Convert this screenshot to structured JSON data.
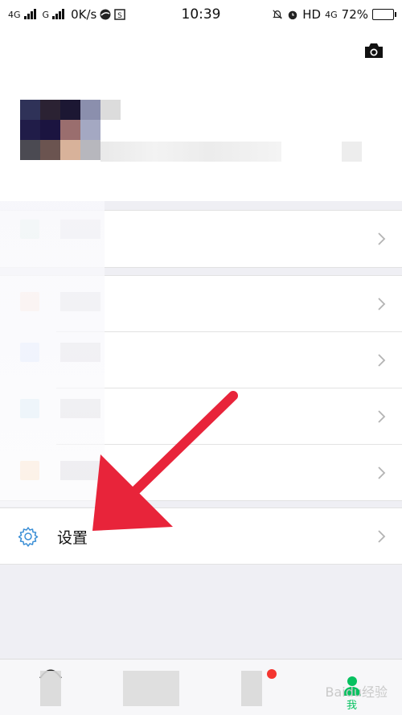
{
  "status_bar": {
    "network1": "4G",
    "network2": "G",
    "speed": "0K/s",
    "time": "10:39",
    "hd": "HD",
    "net4g": "4G",
    "battery": "72%",
    "battery_level": 0.72
  },
  "profile": {
    "camera_icon": "camera-icon"
  },
  "menu": {
    "settings_label": "设置"
  },
  "tabbar": {
    "me_label": "我",
    "accent": "#07c160"
  },
  "annotation": {
    "arrow_color": "#e8243a"
  },
  "watermark": "Baidu经验"
}
